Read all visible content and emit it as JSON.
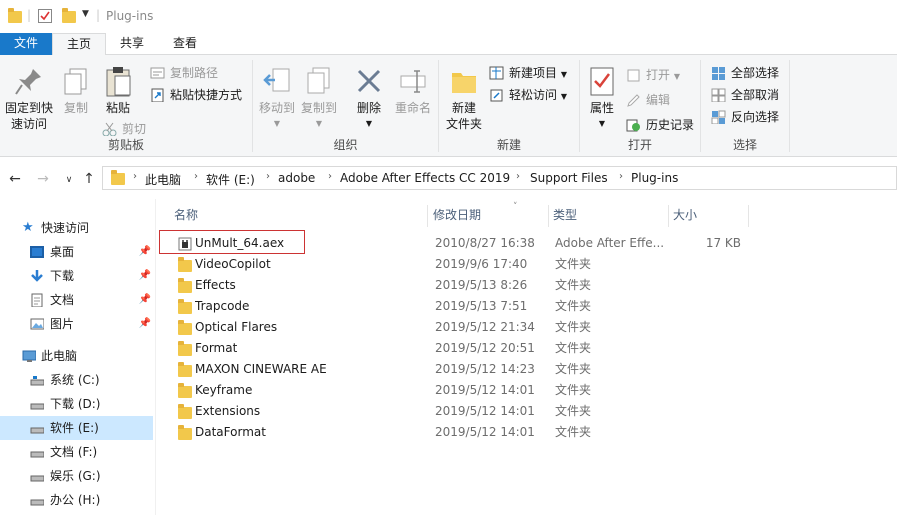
{
  "window": {
    "title": "Plug-ins"
  },
  "tabs": [
    {
      "label": "文件"
    },
    {
      "label": "主页"
    },
    {
      "label": "共享"
    },
    {
      "label": "查看"
    }
  ],
  "ribbon": {
    "clipboard": {
      "label": "剪贴板",
      "pin": "固定到快",
      "pin2": "速访问",
      "copy": "复制",
      "paste": "粘贴",
      "copy_path": "复制路径",
      "paste_shortcut": "粘贴快捷方式",
      "cut": "剪切"
    },
    "organize": {
      "label": "组织",
      "move_to": "移动到",
      "copy_to": "复制到",
      "delete": "删除",
      "rename": "重命名"
    },
    "new": {
      "label": "新建",
      "new_item": "新建项目",
      "easy_access": "轻松访问",
      "new_folder": "新建",
      "new_folder2": "文件夹"
    },
    "open": {
      "label": "打开",
      "properties": "属性",
      "open": "打开",
      "edit": "编辑",
      "history": "历史记录"
    },
    "select": {
      "label": "选择",
      "select_all": "全部选择",
      "select_none": "全部取消",
      "invert": "反向选择"
    }
  },
  "address": {
    "crumbs": [
      "此电脑",
      "软件 (E:)",
      "adobe",
      "Adobe After Effects CC 2019",
      "Support Files",
      "Plug-ins"
    ]
  },
  "nav": {
    "quick_access": "快速访问",
    "quick": [
      "桌面",
      "下载",
      "文档",
      "图片"
    ],
    "this_pc": "此电脑",
    "drives": [
      "系统 (C:)",
      "下载 (D:)",
      "软件 (E:)",
      "文档 (F:)",
      "娱乐 (G:)",
      "办公 (H:)"
    ]
  },
  "columns": {
    "name": "名称",
    "date": "修改日期",
    "type": "类型",
    "size": "大小"
  },
  "files": [
    {
      "name": "UnMult_64.aex",
      "date": "2010/8/27 16:38",
      "type": "Adobe After Effe...",
      "size": "17 KB",
      "icon": "plugin-file-icon"
    },
    {
      "name": "VideoCopilot",
      "date": "2019/9/6 17:40",
      "type": "文件夹",
      "size": "",
      "icon": "folder-icon"
    },
    {
      "name": "Effects",
      "date": "2019/5/13 8:26",
      "type": "文件夹",
      "size": "",
      "icon": "folder-icon"
    },
    {
      "name": "Trapcode",
      "date": "2019/5/13 7:51",
      "type": "文件夹",
      "size": "",
      "icon": "folder-icon"
    },
    {
      "name": "Optical Flares",
      "date": "2019/5/12 21:34",
      "type": "文件夹",
      "size": "",
      "icon": "folder-icon"
    },
    {
      "name": "Format",
      "date": "2019/5/12 20:51",
      "type": "文件夹",
      "size": "",
      "icon": "folder-icon"
    },
    {
      "name": "MAXON CINEWARE AE",
      "date": "2019/5/12 14:23",
      "type": "文件夹",
      "size": "",
      "icon": "folder-icon"
    },
    {
      "name": "Keyframe",
      "date": "2019/5/12 14:01",
      "type": "文件夹",
      "size": "",
      "icon": "folder-icon"
    },
    {
      "name": "Extensions",
      "date": "2019/5/12 14:01",
      "type": "文件夹",
      "size": "",
      "icon": "folder-icon"
    },
    {
      "name": "DataFormat",
      "date": "2019/5/12 14:01",
      "type": "文件夹",
      "size": "",
      "icon": "folder-icon"
    }
  ],
  "colors": {
    "accent": "#1979ca",
    "selection": "#cce8ff",
    "folder": "#f2c84b",
    "highlight_box": "#cc3333"
  }
}
